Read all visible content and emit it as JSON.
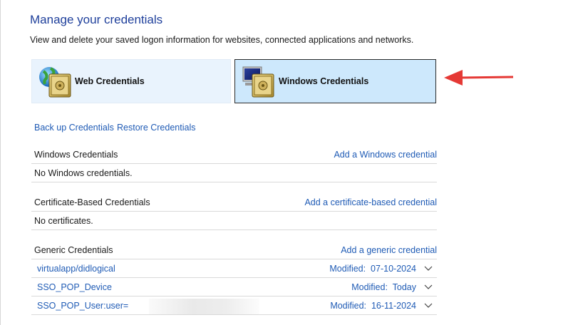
{
  "header": {
    "title": "Manage your credentials",
    "subtitle": "View and delete your saved logon information for websites, connected applications and networks."
  },
  "tabs": {
    "web": {
      "label": "Web Credentials",
      "selected": false
    },
    "windows": {
      "label": "Windows Credentials",
      "selected": true
    }
  },
  "actions": {
    "backup": "Back up Credentials",
    "restore": "Restore Credentials"
  },
  "sections": {
    "windows": {
      "title": "Windows Credentials",
      "add": "Add a Windows credential",
      "empty": "No Windows credentials."
    },
    "certificate": {
      "title": "Certificate-Based Credentials",
      "add": "Add a certificate-based credential",
      "empty": "No certificates."
    },
    "generic": {
      "title": "Generic Credentials",
      "add": "Add a generic credential",
      "items": [
        {
          "name": "virtualapp/didlogical",
          "modified": "Modified:  07-10-2024"
        },
        {
          "name": "SSO_POP_Device",
          "modified": "Modified:  Today"
        },
        {
          "name": "SSO_POP_User:user=",
          "modified": "Modified:  16-11-2024"
        }
      ]
    }
  },
  "colors": {
    "link": "#1f5bb5",
    "title": "#1e3f9b",
    "selected_tab": "#cde8fc",
    "annotation_arrow": "#e53935"
  },
  "icons": [
    "globe-safe-icon",
    "monitor-safe-icon",
    "chevron-down-icon",
    "red-arrow-icon"
  ]
}
